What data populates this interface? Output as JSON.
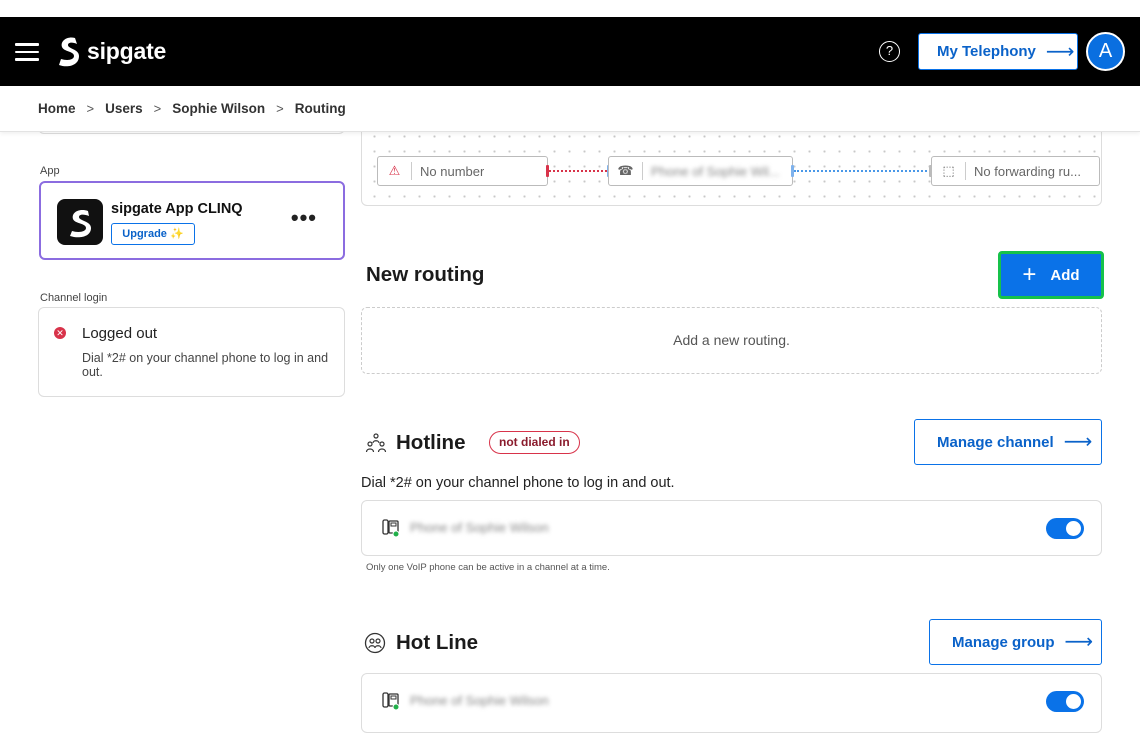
{
  "header": {
    "logo_text": "sipgate",
    "help_glyph": "?",
    "telephony_label": "My Telephony",
    "telephony_arrow": "⟶",
    "avatar_initial": "A"
  },
  "breadcrumb": {
    "items": [
      "Home",
      "Users",
      "Sophie Wilson"
    ],
    "separator": ">",
    "current": "Routing"
  },
  "sidebar": {
    "app_section_label": "App",
    "app": {
      "name": "sipgate App CLINQ",
      "upgrade_label": "Upgrade",
      "upgrade_sparkle": "✨",
      "more_glyph": "•••"
    },
    "channel_login_label": "Channel login",
    "channel_login": {
      "status_glyph": "✕",
      "title": "Logged out",
      "description": "Dial *2# on your channel phone to log in and out."
    }
  },
  "graph": {
    "nodes": [
      {
        "icon": "⚠",
        "label": "No number"
      },
      {
        "icon": "☎",
        "label": "Phone of Sophie Wil..."
      },
      {
        "icon": "⬚",
        "label": "No forwarding ru..."
      }
    ]
  },
  "new_routing": {
    "title": "New routing",
    "add_plus": "+",
    "add_label": "Add",
    "empty_text": "Add a new routing."
  },
  "hotline": {
    "title": "Hotline",
    "badge": "not dialed in",
    "manage_label": "Manage channel",
    "manage_arrow": "⟶",
    "hint": "Dial *2# on your channel phone to log in and out.",
    "phone_name": "Phone of Sophie Wilson",
    "toggle_on": true,
    "note": "Only one VoIP phone can be active in a channel at a time."
  },
  "hot_line": {
    "title": "Hot Line",
    "manage_label": "Manage group",
    "manage_arrow": "⟶",
    "phone_name": "Phone of Sophie Wilson",
    "toggle_on": true
  },
  "colors": {
    "accent": "#0a72e8",
    "danger": "#d8334a",
    "app_card_border": "#8b6ce0",
    "add_focus_ring": "#16c24a"
  }
}
